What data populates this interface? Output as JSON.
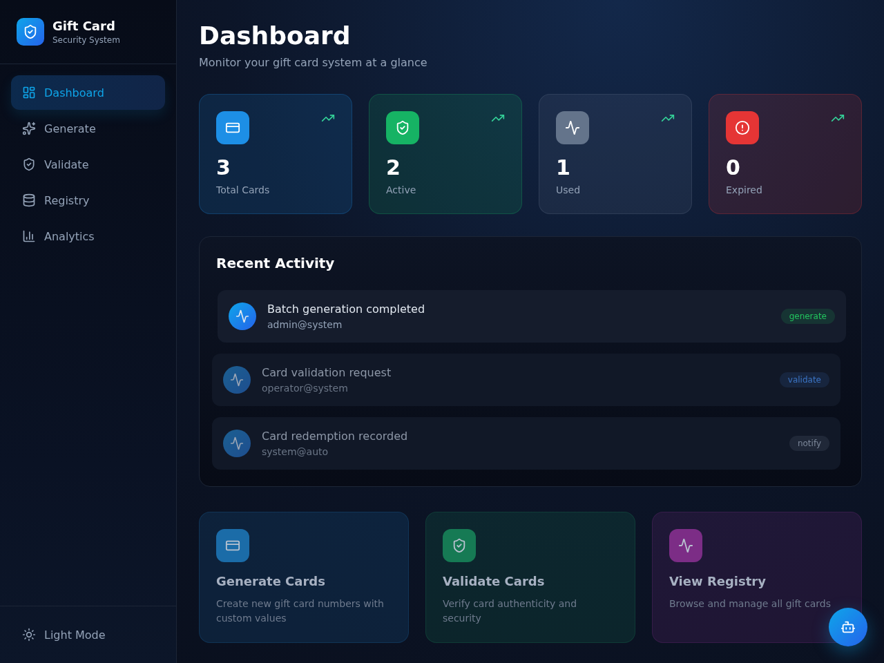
{
  "sidebar": {
    "brand": {
      "title": "Gift Card",
      "subtitle": "Security System"
    },
    "nav": [
      {
        "label": "Dashboard",
        "kind": "dashboard",
        "selected": true
      },
      {
        "label": "Generate",
        "kind": "sparkles",
        "selected": false
      },
      {
        "label": "Validate",
        "kind": "shield",
        "selected": false
      },
      {
        "label": "Registry",
        "kind": "database",
        "selected": false
      },
      {
        "label": "Analytics",
        "kind": "chart",
        "selected": false
      }
    ],
    "theme_toggle": {
      "label": "Light Mode"
    }
  },
  "header": {
    "title": "Dashboard",
    "subtitle": "Monitor your gift card system at a glance"
  },
  "stats": [
    {
      "value": "3",
      "label": "Total Cards",
      "kind": "card",
      "color": "#1d8fe6"
    },
    {
      "value": "2",
      "label": "Active",
      "kind": "shield",
      "color": "#16b364"
    },
    {
      "value": "1",
      "label": "Used",
      "kind": "activity",
      "color": "#64748b"
    },
    {
      "value": "0",
      "label": "Expired",
      "kind": "alert",
      "color": "#e53535"
    }
  ],
  "recent_activity": {
    "title": "Recent Activity",
    "items": [
      {
        "title": "Batch generation completed",
        "user": "admin@system",
        "tag": "generate",
        "color": "#22c55e",
        "dimmed": false
      },
      {
        "title": "Card validation request",
        "user": "operator@system",
        "tag": "validate",
        "color": "#3b74c4",
        "dimmed": true
      },
      {
        "title": "Card redemption recorded",
        "user": "system@auto",
        "tag": "notify",
        "color": "#7c8799",
        "dimmed": true
      }
    ]
  },
  "quick_actions": [
    {
      "title": "Generate Cards",
      "description": "Create new gift card numbers with custom values",
      "kind": "card",
      "color": "#1b6ca8"
    },
    {
      "title": "Validate Cards",
      "description": "Verify card authenticity and security",
      "kind": "shield",
      "color": "#167a54"
    },
    {
      "title": "View Registry",
      "description": "Browse and manage all gift cards",
      "kind": "activity",
      "color": "#7c2d86"
    }
  ]
}
